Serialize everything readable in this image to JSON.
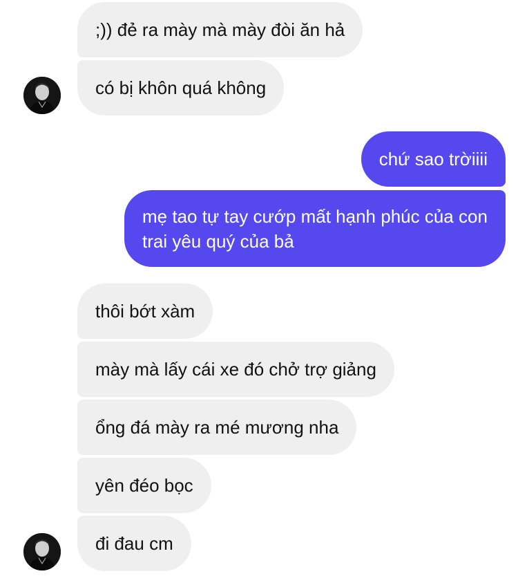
{
  "conversation": {
    "messages": [
      {
        "sender": "them",
        "text": ";)) đẻ ra mày mà mày đòi ăn hả"
      },
      {
        "sender": "them",
        "text": "có bị khôn quá không"
      },
      {
        "sender": "me",
        "text": "chứ sao trời​iii"
      },
      {
        "sender": "me",
        "text": "mẹ tao tự tay cướp mất hạnh phúc của con trai yêu quý của bả"
      },
      {
        "sender": "them",
        "text": "thôi bớt xàm"
      },
      {
        "sender": "them",
        "text": "mày mà lấy cái xe đó chở trợ giảng"
      },
      {
        "sender": "them",
        "text": "ổng đá mày ra mé mương nha"
      },
      {
        "sender": "them",
        "text": "yên đéo bọc"
      },
      {
        "sender": "them",
        "text": "đi đau cm"
      }
    ],
    "contact_avatar_icon": "contact-avatar-icon"
  },
  "colors": {
    "incoming_bubble": "#efefef",
    "outgoing_bubble": "#5548ee",
    "incoming_text": "#111111",
    "outgoing_text": "#ffffff"
  }
}
